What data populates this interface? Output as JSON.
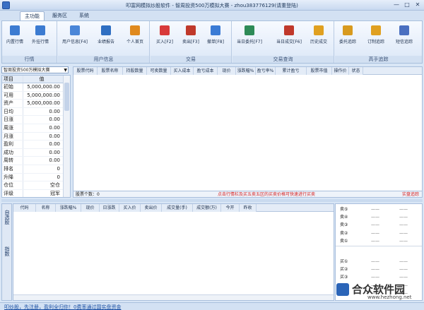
{
  "window": {
    "title": "叩富网模拟炒股软件 - 智周投资500万模拟大赛 - zhou383776129(请重登陆)",
    "min": "—",
    "max": "□",
    "close": "✕"
  },
  "tabs": [
    "主功能",
    "服务区",
    "系统"
  ],
  "ribbon": {
    "groups": [
      {
        "title": "行情",
        "buttons": [
          "内置行情",
          "外挂行情"
        ]
      },
      {
        "title": "用户信息",
        "buttons": [
          "用户信息[F4]",
          "业绩报告",
          "个人首页"
        ]
      },
      {
        "title": "交易",
        "buttons": [
          "买入[F2]",
          "卖出[F3]",
          "撤单[F8]"
        ]
      },
      {
        "title": "交易查询",
        "buttons": [
          "当日委托[F7]",
          "当日成交[F6]",
          "历史成交"
        ]
      },
      {
        "title": "高手追踪",
        "buttons": [
          "委托追踪",
          "订制追踪",
          "短信追踪"
        ]
      }
    ],
    "icon_colors": [
      "#3c7bd1",
      "#3c7bd1",
      "#4a86d8",
      "#2f6fc2",
      "#e08a1e",
      "#d83a3a",
      "#c0392b",
      "#3a7bd5",
      "#2e8b57",
      "#c0392b",
      "#e0a020",
      "#d89a1e",
      "#e0a020",
      "#4a6fc0"
    ]
  },
  "left_panel": {
    "contest": "智周投资500万模拟大赛",
    "headers": [
      "项目",
      "值"
    ],
    "rows": [
      {
        "item": "初始",
        "value": "5,000,000.00"
      },
      {
        "item": "可用",
        "value": "5,000,000.00"
      },
      {
        "item": "资产",
        "value": "5,000,000.00"
      },
      {
        "item": "日均",
        "value": "0.00"
      },
      {
        "item": "日涨",
        "value": "0.00"
      },
      {
        "item": "周涨",
        "value": "0.00"
      },
      {
        "item": "月涨",
        "value": "0.00"
      },
      {
        "item": "盈利",
        "value": "0.00"
      },
      {
        "item": "成功",
        "value": "0.00"
      },
      {
        "item": "周转",
        "value": "0.00"
      },
      {
        "item": "排名",
        "value": "0"
      },
      {
        "item": "升降",
        "value": "0"
      },
      {
        "item": "仓位",
        "value": "空仓"
      },
      {
        "item": "评级",
        "value": "冠军"
      }
    ]
  },
  "orders_table": {
    "headers": [
      "股票代码",
      "股票名称",
      "持股数量",
      "可卖数量",
      "买入成本",
      "盈亏成本",
      "现价",
      "涨跌幅%",
      "盈亏率%",
      "累计盈亏",
      "股票市值",
      "操作价",
      "状态"
    ]
  },
  "orders_status": {
    "count_label": "股票个数：0",
    "hint": "点击行情栏及买五卖五区的买卖价格可快速进行买卖",
    "real_trade": "实盘追踪"
  },
  "side_tabs": [
    "自选股",
    "指数"
  ],
  "quote_table": {
    "headers": [
      "代码",
      "名称",
      "涨跌幅%",
      "现价",
      "日涨跌",
      "买入价",
      "卖出价",
      "成交量(手)",
      "成交额(万)",
      "今开",
      "昨收"
    ]
  },
  "depth": {
    "sell": [
      "卖⑤",
      "卖④",
      "卖③",
      "卖②",
      "卖①"
    ],
    "buy": [
      "买①",
      "买②",
      "买③",
      "买④",
      "买⑤"
    ],
    "placeholder": "——"
  },
  "watermark": {
    "name": "合众软件园",
    "url": "www.hezhong.net"
  },
  "news": "叩炒股，先注册，盈利全归你！0费率通过国实盘资金"
}
